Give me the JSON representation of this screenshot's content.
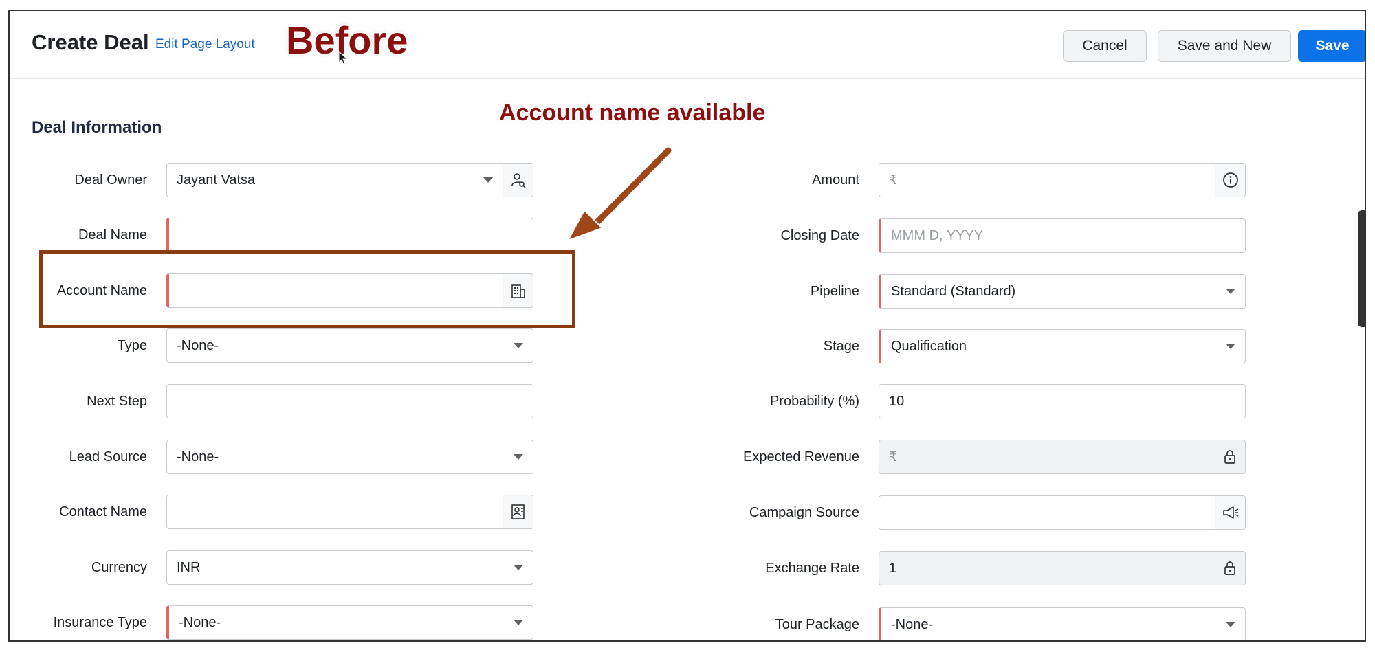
{
  "header": {
    "title": "Create Deal",
    "edit_layout_link": "Edit Page Layout",
    "buttons": {
      "cancel": "Cancel",
      "save_and_new": "Save and New",
      "save": "Save"
    }
  },
  "annotations": {
    "before": "Before",
    "callout": "Account name available"
  },
  "section": {
    "title": "Deal Information"
  },
  "left_fields": {
    "deal_owner": {
      "label": "Deal Owner",
      "value": "Jayant Vatsa"
    },
    "deal_name": {
      "label": "Deal Name",
      "value": ""
    },
    "account_name": {
      "label": "Account Name",
      "value": ""
    },
    "type": {
      "label": "Type",
      "value": "-None-"
    },
    "next_step": {
      "label": "Next Step",
      "value": ""
    },
    "lead_source": {
      "label": "Lead Source",
      "value": "-None-"
    },
    "contact_name": {
      "label": "Contact Name",
      "value": ""
    },
    "currency": {
      "label": "Currency",
      "value": "INR"
    },
    "insurance_type": {
      "label": "Insurance Type",
      "value": "-None-"
    }
  },
  "right_fields": {
    "amount": {
      "label": "Amount",
      "symbol": "₹",
      "value": ""
    },
    "closing_date": {
      "label": "Closing Date",
      "placeholder": "MMM D, YYYY"
    },
    "pipeline": {
      "label": "Pipeline",
      "value": "Standard (Standard)"
    },
    "stage": {
      "label": "Stage",
      "value": "Qualification"
    },
    "probability": {
      "label": "Probability (%)",
      "value": "10"
    },
    "expected_revenue": {
      "label": "Expected Revenue",
      "symbol": "₹",
      "value": ""
    },
    "campaign_source": {
      "label": "Campaign Source",
      "value": ""
    },
    "exchange_rate": {
      "label": "Exchange Rate",
      "value": "1"
    },
    "tour_package": {
      "label": "Tour Package",
      "value": "-None-"
    }
  },
  "colors": {
    "primary": "#0b72e7",
    "required": "#e5635c",
    "annotation": "#8b0f0f",
    "highlight_box": "#8a3b12"
  },
  "icons": {
    "deal_owner": "user-search-icon",
    "account_name": "building-icon",
    "contact_name": "contact-card-icon",
    "amount": "info-icon",
    "expected_revenue": "lock-icon",
    "campaign_source": "megaphone-icon",
    "exchange_rate": "lock-icon"
  }
}
